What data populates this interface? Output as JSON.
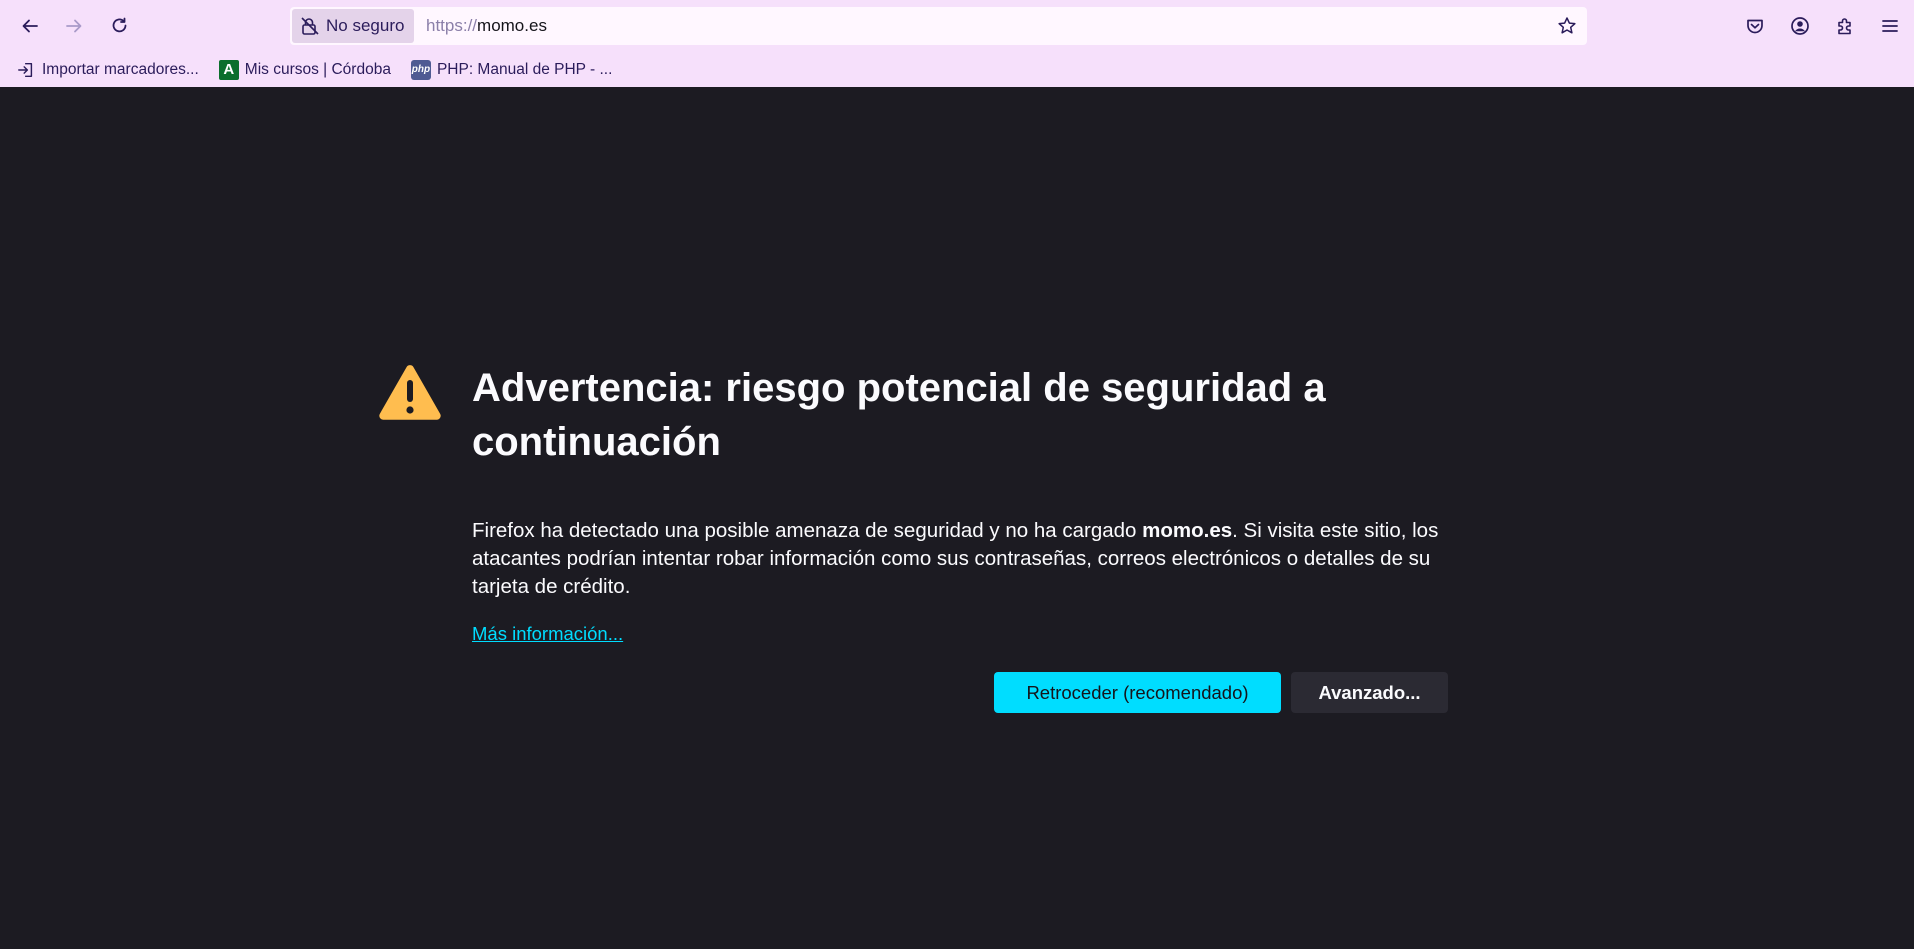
{
  "browser": {
    "identity_label": "No seguro",
    "url_scheme": "https://",
    "url_host": "momo.es",
    "bookmarks": [
      {
        "label": "Importar marcadores...",
        "icon": "import-icon"
      },
      {
        "label": "Mis cursos | Córdoba",
        "icon": "andalucia-favicon",
        "favicon_text": "A"
      },
      {
        "label": "PHP: Manual de PHP - ...",
        "icon": "php-favicon",
        "favicon_text": "php"
      }
    ],
    "toolbar_icons": [
      "back-icon",
      "forward-icon",
      "reload-icon",
      "lock-warning-icon",
      "star-icon",
      "pocket-icon",
      "account-icon",
      "extensions-icon",
      "menu-icon"
    ]
  },
  "error_page": {
    "title": "Advertencia: riesgo potencial de seguridad a continuación",
    "description_prefix": "Firefox ha detectado una posible amenaza de seguridad y no ha cargado ",
    "description_host": "momo.es",
    "description_suffix": ". Si visita este sitio, los atacantes podrían intentar robar información como sus contraseñas, correos electrónicos o detalles de su tarjeta de crédito.",
    "learn_more": "Más información...",
    "primary_button": "Retroceder (recomendado)",
    "secondary_button": "Avanzado..."
  },
  "colors": {
    "chrome_bg": "#f6e0fb",
    "page_bg": "#1c1b22",
    "accent": "#00ddff",
    "warning": "#ffbd4f"
  }
}
